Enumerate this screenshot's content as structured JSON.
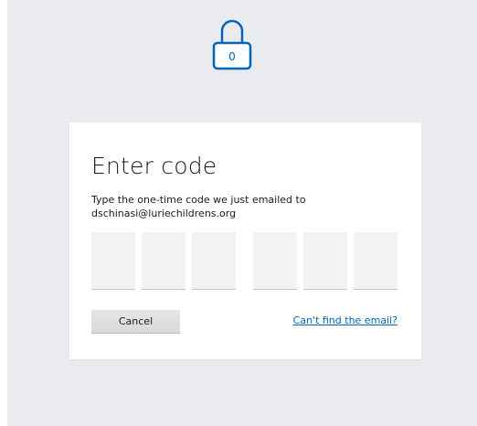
{
  "icons": {
    "lock": "lock-icon",
    "lock_digit": "0"
  },
  "colors": {
    "accent": "#0067b8",
    "background": "#eaebef",
    "code_box": "#f2f2f2"
  },
  "dialog": {
    "title": "Enter code",
    "instruction": "Type the one-time code we just emailed to",
    "email": "dschinasi@luriechildrens.org",
    "cancel_label": "Cancel",
    "help_link": "Can't find the email?"
  }
}
